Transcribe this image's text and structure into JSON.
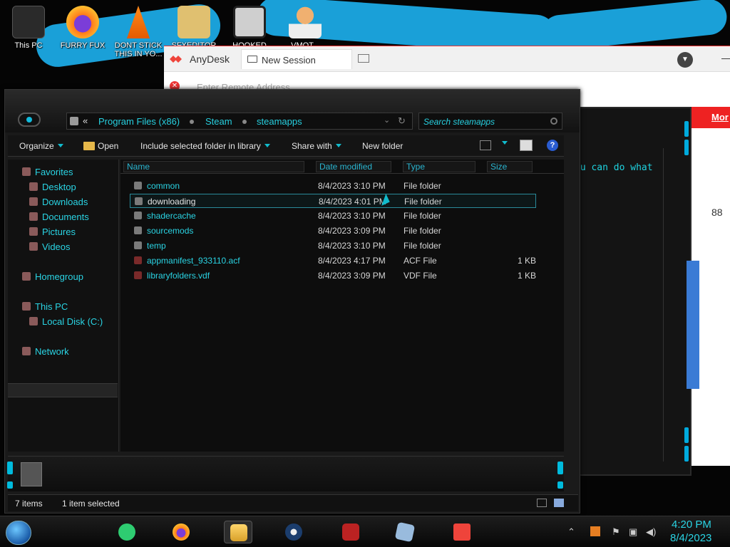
{
  "desktop_icons": [
    {
      "label": "This PC"
    },
    {
      "label": "FURRY FUX"
    },
    {
      "label": "DONT STICK THIS IN YO..."
    },
    {
      "label": "SFXEDITOR"
    },
    {
      "label": "HOOKED ON..."
    },
    {
      "label": "VMOT..."
    }
  ],
  "anydesk": {
    "app_name": "AnyDesk",
    "tab_label": "New Session",
    "address_placeholder": "Enter Remote Address",
    "remote_text": "ou can do what",
    "remote_link": "Mor"
  },
  "explorer": {
    "breadcrumb": {
      "prefix": "«",
      "items": [
        "Program Files (x86)",
        "Steam",
        "steamapps"
      ]
    },
    "search_placeholder": "Search steamapps",
    "commands": {
      "organize": "Organize",
      "open": "Open",
      "include": "Include selected folder in library",
      "share": "Share with",
      "new_folder": "New folder"
    },
    "nav": {
      "favorites": "Favorites",
      "desktop": "Desktop",
      "downloads": "Downloads",
      "documents": "Documents",
      "pictures": "Pictures",
      "videos": "Videos",
      "homegroup": "Homegroup",
      "this_pc": "This PC",
      "local_disk": "Local Disk (C:)",
      "network": "Network"
    },
    "columns": {
      "name": "Name",
      "date": "Date modified",
      "type": "Type",
      "size": "Size"
    },
    "files": [
      {
        "name": "common",
        "date": "8/4/2023 3:10 PM",
        "type": "File folder",
        "size": ""
      },
      {
        "name": "downloading",
        "date": "8/4/2023 4:01 PM",
        "type": "File folder",
        "size": ""
      },
      {
        "name": "shadercache",
        "date": "8/4/2023 3:10 PM",
        "type": "File folder",
        "size": ""
      },
      {
        "name": "sourcemods",
        "date": "8/4/2023 3:09 PM",
        "type": "File folder",
        "size": ""
      },
      {
        "name": "temp",
        "date": "8/4/2023 3:10 PM",
        "type": "File folder",
        "size": ""
      },
      {
        "name": "appmanifest_933110.acf",
        "date": "8/4/2023 4:17 PM",
        "type": "ACF File",
        "size": "1 KB"
      },
      {
        "name": "libraryfolders.vdf",
        "date": "8/4/2023 3:09 PM",
        "type": "VDF File",
        "size": "1 KB"
      }
    ],
    "status": {
      "count": "7 items",
      "selected": "1 item selected"
    }
  },
  "taskbar": {
    "time": "4:20 PM",
    "date": "8/4/2023"
  },
  "colors": {
    "accent_cyan": "#2ad4e4",
    "anydesk_red": "#ef443b"
  }
}
